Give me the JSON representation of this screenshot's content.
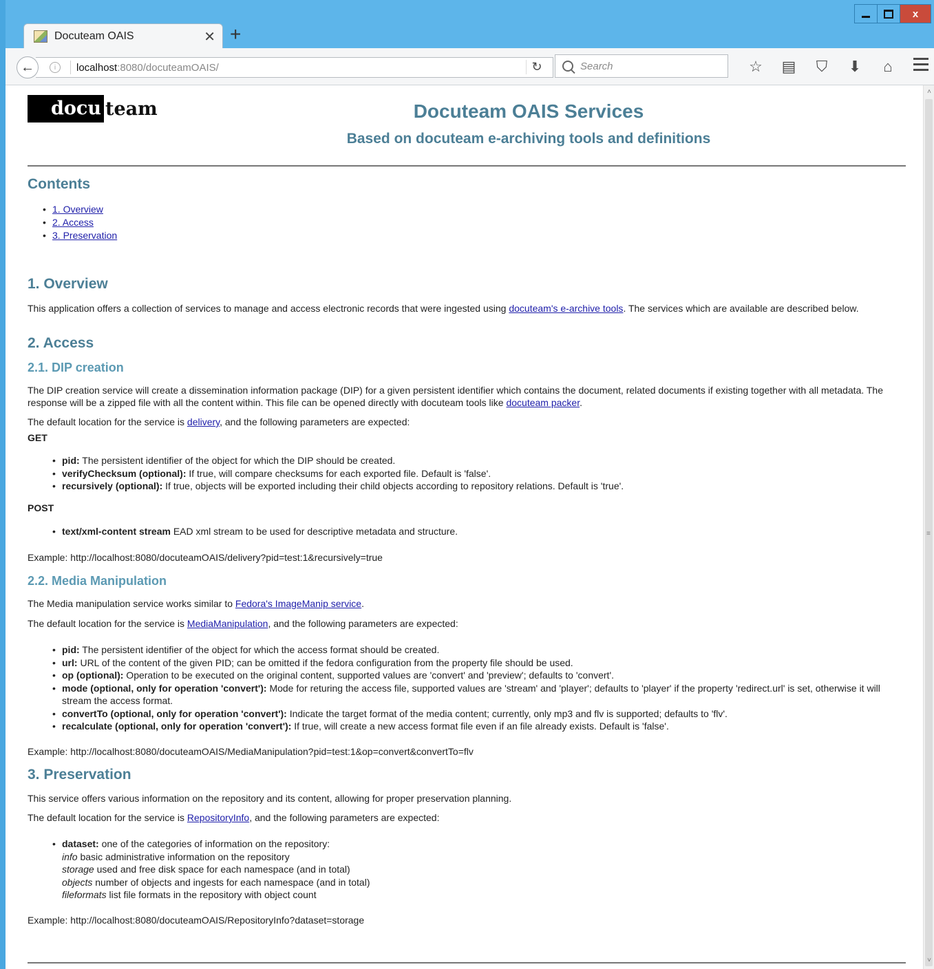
{
  "browser": {
    "tab_title": "Docuteam OAIS",
    "tab_close": "✕",
    "new_tab": "+",
    "url_host": "localhost",
    "url_path": ":8080/docuteamOAIS/",
    "search_placeholder": "Search",
    "window_close": "x"
  },
  "header": {
    "logo_part1": "docu",
    "logo_part2": "team",
    "title": "Docuteam OAIS Services",
    "subtitle": "Based on docuteam e-archiving tools and definitions"
  },
  "contents": {
    "heading": "Contents",
    "items": [
      "1. Overview",
      "2. Access",
      "3. Preservation"
    ]
  },
  "overview": {
    "heading": "1. Overview",
    "text_before": "This application offers a collection of services to manage and access electronic records that were ingested using ",
    "link": "docuteam's e-archive tools",
    "text_after": ". The services which are available are described below."
  },
  "access": {
    "heading": "2. Access",
    "dip": {
      "heading": "2.1. DIP creation",
      "desc_before": "The DIP creation service will create a dissemination information package (DIP) for a given persistent identifier which contains the document, related documents if existing together with all metadata. The response will be a zipped file with all the content within. This file can be opened directly with docuteam tools like ",
      "desc_link": "docuteam packer",
      "desc_after": ".",
      "loc_before": "The default location for the service is ",
      "loc_link": "delivery",
      "loc_after": ", and the following parameters are expected:",
      "get_label": "GET",
      "get_params": [
        {
          "name": "pid:",
          "desc": " The persistent identifier of the object for which the DIP should be created."
        },
        {
          "name": "verifyChecksum (optional):",
          "desc": " If true, will compare checksums for each exported file. Default is 'false'."
        },
        {
          "name": "recursively (optional):",
          "desc": " If true, objects will be exported including their child objects according to repository relations. Default is 'true'."
        }
      ],
      "post_label": "POST",
      "post_params": [
        {
          "name": "text/xml-content stream",
          "desc": " EAD xml stream to be used for descriptive metadata and structure."
        }
      ],
      "example": "Example: http://localhost:8080/docuteamOAIS/delivery?pid=test:1&recursively=true"
    },
    "media": {
      "heading": "2.2. Media Manipulation",
      "desc_before": "The Media manipulation service works similar to ",
      "desc_link": "Fedora's ImageManip service",
      "desc_after": ".",
      "loc_before": "The default location for the service is ",
      "loc_link": "MediaManipulation",
      "loc_after": ", and the following parameters are expected:",
      "params": [
        {
          "name": "pid:",
          "desc": " The persistent identifier of the object for which the access format should be created."
        },
        {
          "name": "url:",
          "desc": " URL of the content of the given PID; can be omitted if the fedora configuration from the property file should be used."
        },
        {
          "name": "op (optional):",
          "desc": " Operation to be executed on the original content, supported values are 'convert' and 'preview'; defaults to 'convert'."
        },
        {
          "name": "mode (optional, only for operation 'convert'):",
          "desc": " Mode for returing the access file, supported values are 'stream' and 'player'; defaults to 'player' if the property 'redirect.url' is set, otherwise it will stream the access format."
        },
        {
          "name": "convertTo (optional, only for operation 'convert'):",
          "desc": " Indicate the target format of the media content; currently, only mp3 and flv is supported; defaults to 'flv'."
        },
        {
          "name": "recalculate (optional, only for operation 'convert'):",
          "desc": " If true, will create a new access format file even if an file already exists. Default is 'false'."
        }
      ],
      "example": "Example: http://localhost:8080/docuteamOAIS/MediaManipulation?pid=test:1&op=convert&convertTo=flv"
    }
  },
  "preservation": {
    "heading": "3. Preservation",
    "desc": "This service offers various information on the repository and its content, allowing for proper preservation planning.",
    "loc_before": "The default location for the service is ",
    "loc_link": "RepositoryInfo",
    "loc_after": ", and the following parameters are expected:",
    "dataset_name": "dataset:",
    "dataset_desc": " one of the categories of information on the repository:",
    "datasets": [
      {
        "key": "info",
        "desc": " basic administrative information on the repository"
      },
      {
        "key": "storage",
        "desc": " used and free disk space for each namespace (and in total)"
      },
      {
        "key": "objects",
        "desc": " number of objects and ingests for each namespace (and in total)"
      },
      {
        "key": "fileformats",
        "desc": " list file formats in the repository with object count"
      }
    ],
    "example": "Example: http://localhost:8080/docuteamOAIS/RepositoryInfo?dataset=storage"
  }
}
